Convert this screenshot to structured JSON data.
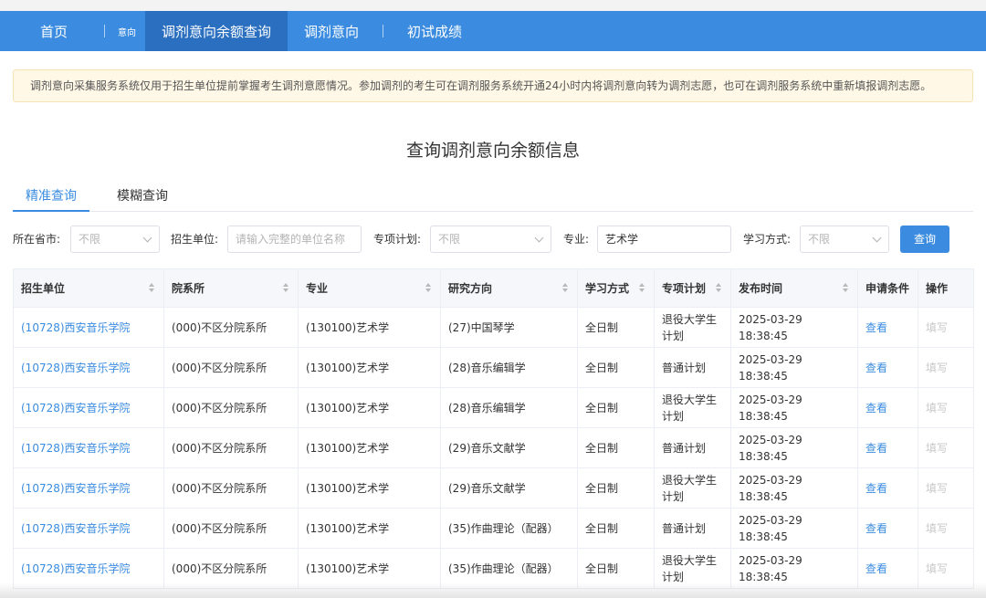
{
  "nav": {
    "items": [
      {
        "label": "首页"
      },
      {
        "label": "意向"
      },
      {
        "label": "调剂意向余额查询"
      },
      {
        "label": "调剂意向"
      },
      {
        "label": "初试成绩"
      }
    ]
  },
  "notice": "调剂意向采集服务系统仅用于招生单位提前掌握考生调剂意愿情况。参加调剂的考生可在调剂服务系统开通24小时内将调剂意向转为调剂志愿，也可在调剂服务系统中重新填报调剂志愿。",
  "page_title": "查询调剂意向余额信息",
  "tabs": {
    "exact": "精准查询",
    "fuzzy": "模糊查询"
  },
  "filters": {
    "province_label": "所在省市:",
    "province_value": "不限",
    "unit_label": "招生单位:",
    "unit_placeholder": "请输入完整的单位名称",
    "plan_label": "专项计划:",
    "plan_value": "不限",
    "major_label": "专业:",
    "major_value": "艺术学",
    "mode_label": "学习方式:",
    "mode_value": "不限",
    "search_label": "查询"
  },
  "table": {
    "headers": [
      "招生单位",
      "院系所",
      "专业",
      "研究方向",
      "学习方式",
      "专项计划",
      "发布时间",
      "申请条件",
      "操作"
    ],
    "rows": [
      {
        "unit": "(10728)西安音乐学院",
        "dept": "(000)不区分院系所",
        "major": "(130100)艺术学",
        "direction": "(27)中国琴学",
        "mode": "全日制",
        "plan": "退役大学生计划",
        "time": "2025-03-29 18:38:45",
        "cond": "查看",
        "op": "填写"
      },
      {
        "unit": "(10728)西安音乐学院",
        "dept": "(000)不区分院系所",
        "major": "(130100)艺术学",
        "direction": "(28)音乐编辑学",
        "mode": "全日制",
        "plan": "普通计划",
        "time": "2025-03-29 18:38:45",
        "cond": "查看",
        "op": "填写"
      },
      {
        "unit": "(10728)西安音乐学院",
        "dept": "(000)不区分院系所",
        "major": "(130100)艺术学",
        "direction": "(28)音乐编辑学",
        "mode": "全日制",
        "plan": "退役大学生计划",
        "time": "2025-03-29 18:38:45",
        "cond": "查看",
        "op": "填写"
      },
      {
        "unit": "(10728)西安音乐学院",
        "dept": "(000)不区分院系所",
        "major": "(130100)艺术学",
        "direction": "(29)音乐文献学",
        "mode": "全日制",
        "plan": "普通计划",
        "time": "2025-03-29 18:38:45",
        "cond": "查看",
        "op": "填写"
      },
      {
        "unit": "(10728)西安音乐学院",
        "dept": "(000)不区分院系所",
        "major": "(130100)艺术学",
        "direction": "(29)音乐文献学",
        "mode": "全日制",
        "plan": "退役大学生计划",
        "time": "2025-03-29 18:38:45",
        "cond": "查看",
        "op": "填写"
      },
      {
        "unit": "(10728)西安音乐学院",
        "dept": "(000)不区分院系所",
        "major": "(130100)艺术学",
        "direction": "(35)作曲理论（配器）",
        "mode": "全日制",
        "plan": "普通计划",
        "time": "2025-03-29 18:38:45",
        "cond": "查看",
        "op": "填写"
      },
      {
        "unit": "(10728)西安音乐学院",
        "dept": "(000)不区分院系所",
        "major": "(130100)艺术学",
        "direction": "(35)作曲理论（配器）",
        "mode": "全日制",
        "plan": "退役大学生计划",
        "time": "2025-03-29 18:38:45",
        "cond": "查看",
        "op": "填写"
      }
    ]
  }
}
